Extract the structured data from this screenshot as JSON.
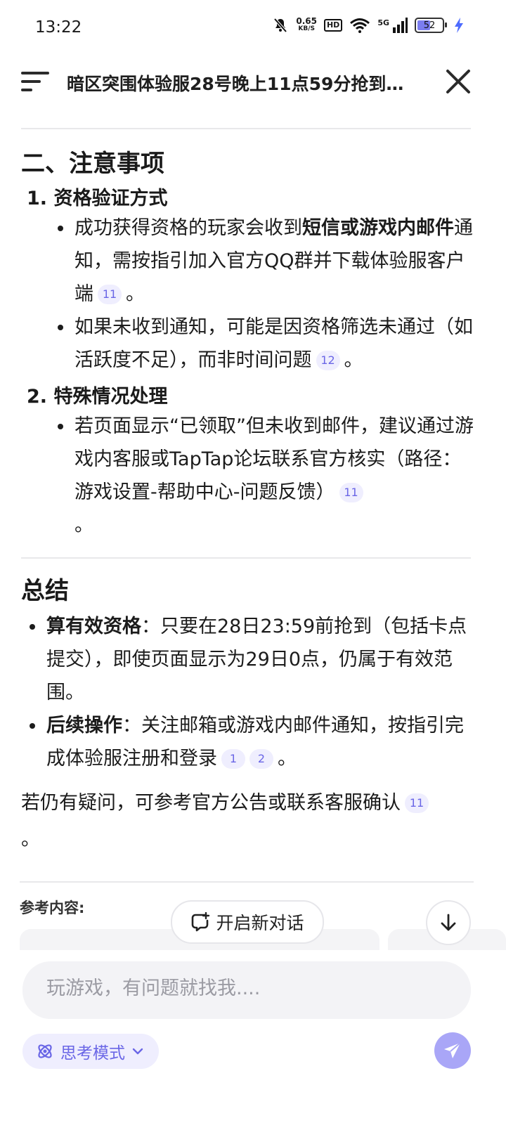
{
  "status_bar": {
    "time": "13:22",
    "net_speed_value": "0.65",
    "net_speed_unit": "KB/S",
    "hd": "HD",
    "signal": "5G",
    "battery": "52"
  },
  "header": {
    "title": "暗区突围体验服28号晚上11点59分抢到资格..."
  },
  "section2": {
    "heading": "二、注意事项",
    "items": [
      {
        "title": "1. 资格验证方式",
        "bullets": [
          {
            "pre": "成功获得资格的玩家会收到",
            "bold": "短信或游戏内邮件",
            "post": "通知，需按指引加入官方QQ群并下载体验服客户端",
            "cite": "11",
            "end": "。"
          },
          {
            "pre": "如果未收到通知，可能是因资格筛选未通过（如活跃度不足），而非时间问题",
            "cite": "12",
            "end": "。"
          }
        ]
      },
      {
        "title": "2. 特殊情况处理",
        "bullets": [
          {
            "pre": "若页面显示“已领取”但未收到邮件，建议通过游戏内客服或TapTap论坛联系官方核实（路径：游戏设置-帮助中心-问题反馈）",
            "cite": "11",
            "end": "。"
          }
        ]
      }
    ]
  },
  "summary": {
    "heading": "总结",
    "bullets": [
      {
        "bold": "算有效资格",
        "text": "：只要在28日23:59前抢到（包括卡点提交），即使页面显示为29日0点，仍属于有效范围。"
      },
      {
        "bold": "后续操作",
        "text": "：关注邮箱或游戏内邮件通知，按指引完成体验服注册和登录",
        "cite1": "1",
        "cite2": "2",
        "end": "。"
      }
    ],
    "closing": "若仍有疑问，可参考官方公告或联系客服确认",
    "closing_cite": "11",
    "closing_end": "。"
  },
  "references": {
    "label": "参考内容:"
  },
  "actions": {
    "new_chat": "开启新对话"
  },
  "input": {
    "placeholder": "玩游戏，有问题就找我...."
  },
  "mode": {
    "label": "思考模式"
  },
  "colors": {
    "accent": "#6a66e6",
    "accent_light": "#efeefe",
    "send": "#a9a6f7"
  }
}
